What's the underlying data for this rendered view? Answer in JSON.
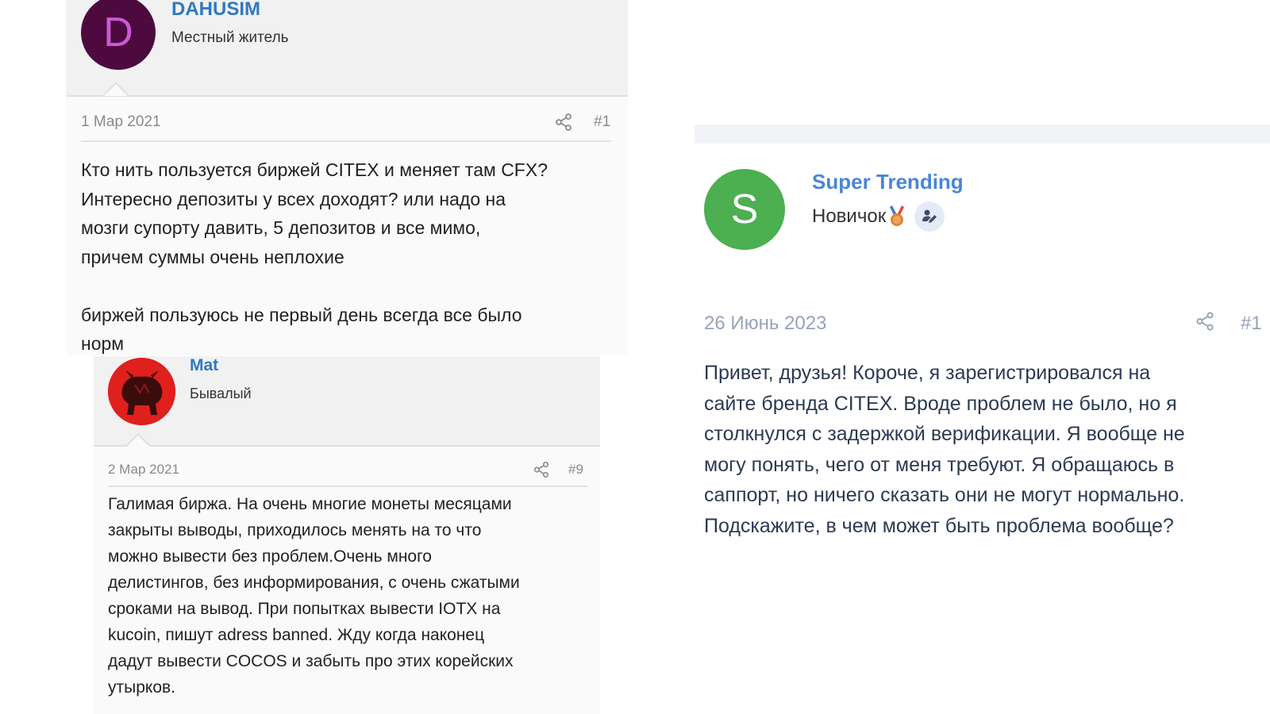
{
  "posts": [
    {
      "avatar_letter": "D",
      "username": "DAHUSIM",
      "user_title": "Местный житель",
      "date": "1 Мар 2021",
      "post_number": "#1",
      "body": "Кто нить пользуется биржей CITEX и меняет там CFX?\nИнтересно депозиты у всех доходят? или надо на\nмозги супорту давить, 5 депозитов и все мимо,\nпричем суммы очень неплохие\n\nбиржей пользуюсь не первый день всегда все было\nнорм",
      "colors": {
        "avatar_bg": "#4d0a3f",
        "avatar_letter": "#c85ad8",
        "username": "#2e79c2"
      }
    },
    {
      "username": "Mat",
      "user_title": "Бывалый",
      "date": "2 Мар 2021",
      "post_number": "#9",
      "body": "Галимая биржа. На очень многие монеты месяцами\nзакрыты выводы, приходилось менять на то что\nможно вывести без проблем.Очень много\nделистингов, без информирования, с очень сжатыми\nсроками на вывод. При попытках вывести IOTX на\nkucoin, пишут adress banned. Жду когда наконец\nдадут вывести COCOS и забыть про этих корейских\nутырков.",
      "colors": {
        "avatar_bg": "#e0201d",
        "username": "#2e79c2"
      }
    },
    {
      "avatar_letter": "S",
      "username": "Super Trending",
      "user_title": "Новичок",
      "date": "26 Июнь 2023",
      "post_number": "#1",
      "body": "Привет, друзья! Короче, я зарегистрировался на\nсайте бренда CITEX. Вроде проблем не было, но я\nстолкнулся с задержкой верификации. Я вообще не\nмогу понять, чего от меня требуют. Я обращаюсь в\nсаппорт, но ничего сказать они не могут нормально.\nПодскажите, в чем может быть проблема вообще?",
      "colors": {
        "avatar_bg": "#4caf50",
        "username": "#4a86d8"
      },
      "icons": [
        "medal-icon",
        "user-edit-icon"
      ]
    }
  ],
  "icons": {
    "share": "share-icon"
  }
}
